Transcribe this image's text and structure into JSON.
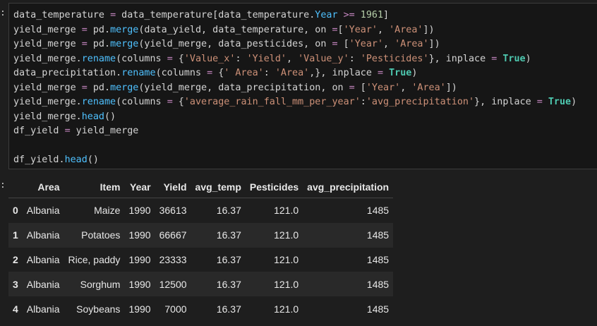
{
  "cell": {
    "prompt_mark": ":",
    "output_mark": ":",
    "code": [
      "data_temperature = data_temperature[data_temperature.Year >= 1961]",
      "yield_merge = pd.merge(data_yield, data_temperature, on =['Year', 'Area'])",
      "yield_merge = pd.merge(yield_merge, data_pesticides, on = ['Year', 'Area'])",
      "yield_merge.rename(columns = {'Value_x': 'Yield', 'Value_y': 'Pesticides'}, inplace = True)",
      "data_precipitation.rename(columns = {' Area': 'Area',}, inplace = True)",
      "yield_merge = pd.merge(yield_merge, data_precipitation, on = ['Year', 'Area'])",
      "yield_merge.rename(columns = {'average_rain_fall_mm_per_year':'avg_precipitation'}, inplace = True)",
      "yield_merge.head()",
      "df_yield = yield_merge",
      "",
      "df_yield.head()"
    ]
  },
  "table": {
    "columns": [
      "Area",
      "Item",
      "Year",
      "Yield",
      "avg_temp",
      "Pesticides",
      "avg_precipitation"
    ],
    "rows": [
      {
        "index": "0",
        "cells": [
          "Albania",
          "Maize",
          "1990",
          "36613",
          "16.37",
          "121.0",
          "1485"
        ]
      },
      {
        "index": "1",
        "cells": [
          "Albania",
          "Potatoes",
          "1990",
          "66667",
          "16.37",
          "121.0",
          "1485"
        ]
      },
      {
        "index": "2",
        "cells": [
          "Albania",
          "Rice, paddy",
          "1990",
          "23333",
          "16.37",
          "121.0",
          "1485"
        ]
      },
      {
        "index": "3",
        "cells": [
          "Albania",
          "Sorghum",
          "1990",
          "12500",
          "16.37",
          "121.0",
          "1485"
        ]
      },
      {
        "index": "4",
        "cells": [
          "Albania",
          "Soybeans",
          "1990",
          "7000",
          "16.37",
          "121.0",
          "1485"
        ]
      }
    ]
  },
  "colors": {
    "background": "#1e1e1e",
    "cell_background": "#161616",
    "keyword_operator": "#c586c0",
    "string": "#ce9178",
    "number": "#b5cea8",
    "boolean": "#4ec9b0",
    "attribute": "#4fc1ff"
  }
}
